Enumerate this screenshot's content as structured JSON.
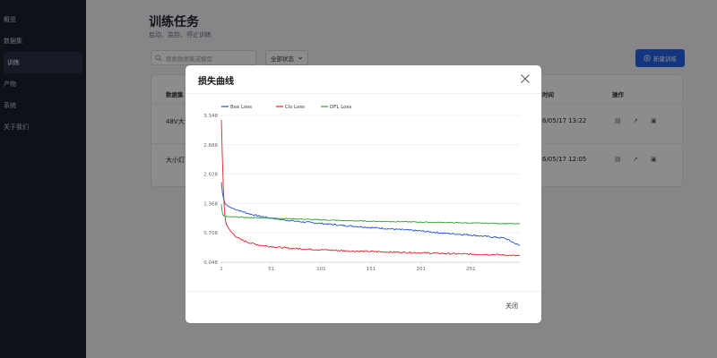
{
  "sidebar": {
    "items": [
      {
        "label": "概览"
      },
      {
        "label": "数据集"
      },
      {
        "label": "训练",
        "active": true
      },
      {
        "label": "产物"
      },
      {
        "label": "系统"
      },
      {
        "label": "关于我们"
      }
    ]
  },
  "header": {
    "title": "训练任务",
    "subtitle": "启动、监控、停止训练"
  },
  "toolbar": {
    "search_placeholder": "搜索数据集或模型",
    "filter_label": "全部状态",
    "new_button_label": "新建训练"
  },
  "table": {
    "headers": {
      "dataset": "数据集",
      "time": "时间",
      "actions": "操作"
    },
    "rows": [
      {
        "dataset": "48V大",
        "time": "6/05/17 13:22"
      },
      {
        "dataset": "大小灯",
        "time": "6/05/17 12:05"
      }
    ]
  },
  "modal": {
    "title": "损失曲线",
    "close_label": "关闭"
  },
  "colors": {
    "accent": "#2563eb",
    "box_loss": "#1f4fe0",
    "cls_loss": "#e0202a",
    "dfl_loss": "#2aa02a"
  },
  "chart_data": {
    "type": "line",
    "legend": [
      "Box Loss",
      "Cls Loss",
      "DFL Loss"
    ],
    "legend_position": "top-left",
    "grid": true,
    "x_ticks": [
      1,
      51,
      101,
      151,
      201,
      251
    ],
    "y_ticks": [
      "0.048",
      "0.708",
      "1.368",
      "2.028",
      "2.688",
      "3.348"
    ],
    "xlim": [
      1,
      300
    ],
    "ylim": [
      0.048,
      3.348
    ],
    "series": [
      {
        "name": "Box Loss",
        "color": "#1f4fe0",
        "x": [
          1,
          2,
          3,
          4,
          5,
          7,
          10,
          15,
          20,
          30,
          40,
          51,
          60,
          80,
          101,
          120,
          151,
          175,
          201,
          225,
          251,
          270,
          285,
          300
        ],
        "y": [
          1.85,
          1.62,
          1.5,
          1.42,
          1.36,
          1.32,
          1.28,
          1.24,
          1.2,
          1.13,
          1.08,
          1.04,
          1.01,
          0.96,
          0.92,
          0.88,
          0.83,
          0.79,
          0.75,
          0.7,
          0.66,
          0.62,
          0.59,
          0.42
        ]
      },
      {
        "name": "Cls Loss",
        "color": "#e0202a",
        "x": [
          1,
          2,
          3,
          4,
          5,
          6,
          8,
          10,
          15,
          20,
          30,
          40,
          51,
          70,
          101,
          130,
          151,
          180,
          201,
          230,
          251,
          275,
          300
        ],
        "y": [
          3.25,
          2.4,
          1.7,
          1.25,
          1.0,
          0.9,
          0.82,
          0.75,
          0.64,
          0.56,
          0.48,
          0.43,
          0.4,
          0.36,
          0.33,
          0.3,
          0.29,
          0.27,
          0.26,
          0.24,
          0.23,
          0.22,
          0.19
        ]
      },
      {
        "name": "DFL Loss",
        "color": "#2aa02a",
        "x": [
          1,
          2,
          3,
          5,
          8,
          12,
          20,
          30,
          51,
          80,
          101,
          130,
          151,
          180,
          201,
          230,
          251,
          280,
          300
        ],
        "y": [
          1.35,
          1.16,
          1.1,
          1.08,
          1.07,
          1.07,
          1.06,
          1.05,
          1.04,
          1.02,
          1.0,
          0.98,
          0.97,
          0.96,
          0.95,
          0.94,
          0.93,
          0.92,
          0.91
        ]
      }
    ]
  }
}
